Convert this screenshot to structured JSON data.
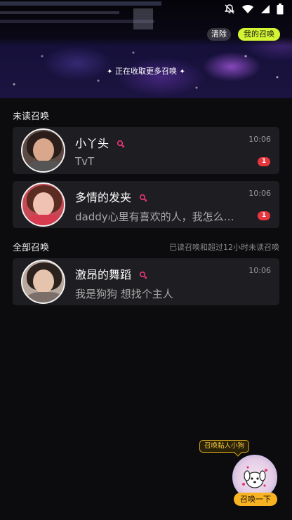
{
  "header": {
    "clear_label": "清除",
    "my_summons_label": "我的召唤",
    "collecting_text": "正在收取更多召唤"
  },
  "sections": {
    "unread_title": "未读召唤",
    "all_title": "全部召唤",
    "all_note": "已读召唤和超过12小时未读召唤"
  },
  "unread": [
    {
      "name": "小丫头",
      "time": "10:06",
      "message": "TvT",
      "badge": "1",
      "gender": "female"
    },
    {
      "name": "多情的发夹",
      "time": "10:06",
      "message": "daddy心里有喜欢的人，我怎么…",
      "badge": "1",
      "gender": "female"
    }
  ],
  "all": [
    {
      "name": "激昂的舞蹈",
      "time": "10:06",
      "message": "我是狗狗 想找个主人",
      "gender": "female"
    }
  ],
  "summon": {
    "bubble_text": "召唤黏人小狗",
    "button_label": "召唤一下"
  },
  "colors": {
    "accent": "#d4f533",
    "badge": "#e8363f",
    "female": "#e8367a",
    "summon": "#f8b323"
  }
}
